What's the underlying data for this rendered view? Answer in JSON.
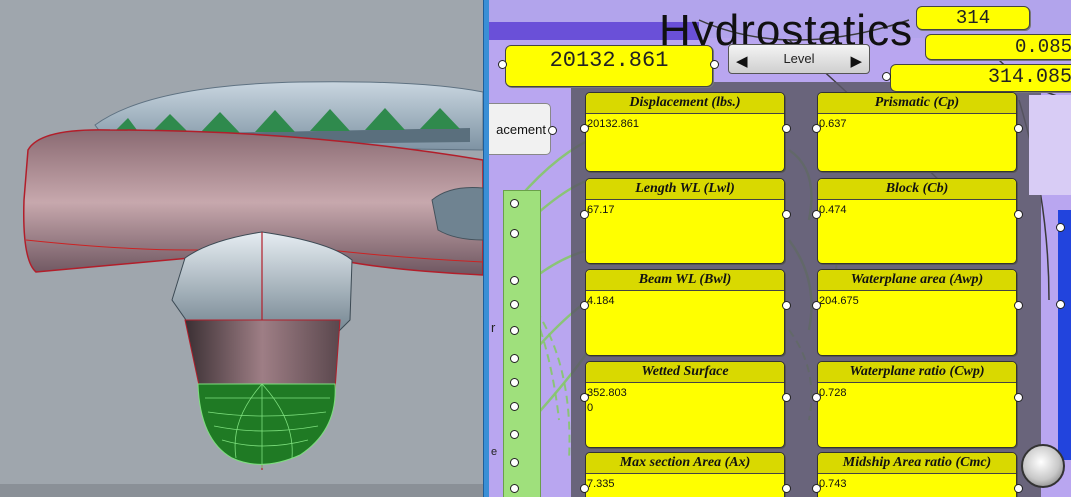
{
  "canvas": {
    "title": "Hydrostatics",
    "top_panels": [
      "314",
      "0.085",
      "314.085"
    ],
    "displacement_input": "20132.861",
    "level_slider_label": "Level",
    "partial_button_label": "acement",
    "side_letter": "r",
    "side_letter2": "e"
  },
  "panels": [
    {
      "title": "Displacement (lbs.)",
      "values": [
        "20132.861"
      ]
    },
    {
      "title": "Prismatic (Cp)",
      "values": [
        "0.637"
      ]
    },
    {
      "title": "Length WL (Lwl)",
      "values": [
        "67.17"
      ]
    },
    {
      "title": "Block (Cb)",
      "values": [
        "0.474"
      ]
    },
    {
      "title": "Beam WL (Bwl)",
      "values": [
        "4.184"
      ]
    },
    {
      "title": "Waterplane area (Awp)",
      "values": [
        "204.675"
      ]
    },
    {
      "title": "Wetted Surface",
      "values": [
        "352.803",
        "0"
      ]
    },
    {
      "title": "Waterplane ratio (Cwp)",
      "values": [
        "0.728"
      ]
    },
    {
      "title": "Max section Area (Ax)",
      "values": [
        "7.335"
      ]
    },
    {
      "title": "Midship Area ratio (Cmc)",
      "values": [
        "0.743"
      ]
    }
  ],
  "colors": {
    "panel_yellow": "#ffff00",
    "canvas_bg": "#b9a6f0",
    "hull_green": "#22aa22",
    "splitter_blue": "#3a8fd6"
  }
}
